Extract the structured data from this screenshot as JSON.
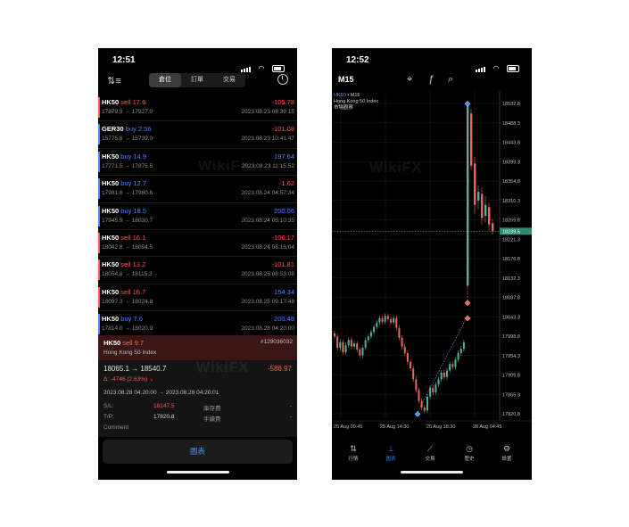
{
  "left": {
    "status_time": "12:51",
    "tabs": [
      "倉位",
      "訂單",
      "交易"
    ],
    "positions": [
      {
        "symbol": "HK50",
        "side": "sell",
        "volume": "17.6",
        "pnl": "-105.78",
        "prices": "17879.9 → 17927.0",
        "datetime": "2023.08.23 08:39:15"
      },
      {
        "symbol": "GER30",
        "side": "buy",
        "volume": "2.56",
        "pnl": "-101.08",
        "prices": "15775.8 → 15739.0",
        "datetime": "2023.08.23 10:41:47"
      },
      {
        "symbol": "HK50",
        "side": "buy",
        "volume": "14.9",
        "pnl": "197.64",
        "prices": "17771.5 → 17875.5",
        "datetime": "2023.08.23 11:15:52"
      },
      {
        "symbol": "HK50",
        "side": "buy",
        "volume": "12.7",
        "pnl": "-1.62",
        "prices": "17981.6 → 17980.6",
        "datetime": "2023.08.24 04:57:34"
      },
      {
        "symbol": "HK50",
        "side": "buy",
        "volume": "18.5",
        "pnl": "200.06",
        "prices": "17945.9 → 18030.7",
        "datetime": "2023.08.24 05:10:35"
      },
      {
        "symbol": "HK50",
        "side": "sell",
        "volume": "16.1",
        "pnl": "-106.17",
        "prices": "18042.8 → 18094.5",
        "datetime": "2023.08.24 06:16:04"
      },
      {
        "symbol": "HK50",
        "side": "sell",
        "volume": "13.2",
        "pnl": "-101.81",
        "prices": "18054.8 → 18115.3",
        "datetime": "2023.08.25 08:53:08"
      },
      {
        "symbol": "HK50",
        "side": "sell",
        "volume": "16.7",
        "pnl": "154.34",
        "prices": "18097.3 → 18024.8",
        "datetime": "2023.08.25 09:17:48"
      },
      {
        "symbol": "HK50",
        "side": "buy",
        "volume": "7.6",
        "pnl": "200.48",
        "prices": "17814.0 → 18020.9",
        "datetime": "2023.08.28 04:20:00"
      }
    ],
    "detail": {
      "symbol": "HK50",
      "side": "sell",
      "volume": "9.7",
      "ticket": "#129036032",
      "name": "Hong Kong 50 Index",
      "prices": "18065.1 → 18540.7",
      "pnl": "-586.97",
      "delta": "Δ: -4746 (2.63%) ⌄",
      "times": "2023.08.28 04:20:00 → 2023.08.28 04:20:01",
      "sl_label": "S/L:",
      "sl_value": "18147.5",
      "tp_label": "T/P:",
      "tp_value": "17820.8",
      "swap_label": "庫存費",
      "fee_label": "手續費",
      "dash": "-",
      "comment_label": "Comment"
    },
    "chart_button": "圖表"
  },
  "right": {
    "status_time": "12:52",
    "timeframe": "M15",
    "chart_symbol": "HK50",
    "chart_tf": "• M15",
    "chart_name": "Hong Kong 50 Index",
    "chart_sub": "市場觀察",
    "current_price": "18239.5",
    "price_ticks": [
      "18532.8",
      "18488.3",
      "18443.8",
      "18399.3",
      "18354.8",
      "18310.3",
      "18265.8",
      "18221.3",
      "18176.8",
      "18132.3",
      "18087.8",
      "18043.3",
      "17998.8",
      "17954.3",
      "17909.8",
      "17865.3",
      "17820.8"
    ],
    "time_ticks": [
      "25 Aug 09:45",
      "25 Aug 14:30",
      "25 Aug 18:30",
      "28 Aug 04:45"
    ],
    "tabs": [
      {
        "icon": "⇅",
        "label": "行情"
      },
      {
        "icon": "⟘",
        "label": "圖表"
      },
      {
        "icon": "⟋",
        "label": "交易"
      },
      {
        "icon": "◷",
        "label": "歷史"
      },
      {
        "icon": "⚙",
        "label": "設置"
      }
    ]
  },
  "colors": {
    "sell": "#ff5b4c",
    "buy": "#4a86ff",
    "bull": "#4fb39a",
    "bear": "#e8665b"
  },
  "watermark": "WikiFX"
}
